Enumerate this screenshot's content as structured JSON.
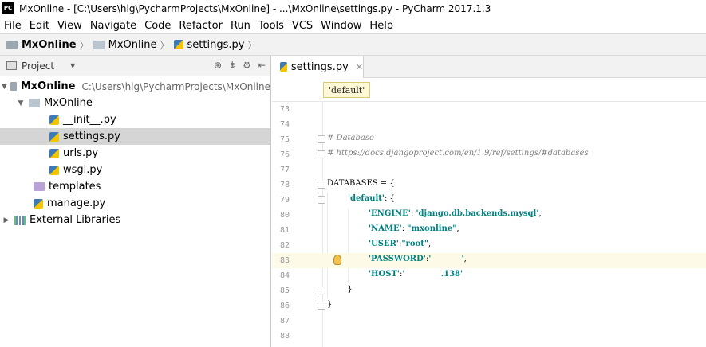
{
  "window": {
    "app_icon_text": "PC",
    "title": "MxOnline - [C:\\Users\\hlg\\PycharmProjects\\MxOnline] - ...\\MxOnline\\settings.py - PyCharm 2017.1.3"
  },
  "menu": [
    "File",
    "Edit",
    "View",
    "Navigate",
    "Code",
    "Refactor",
    "Run",
    "Tools",
    "VCS",
    "Window",
    "Help"
  ],
  "navbar": {
    "crumbs": [
      "MxOnline",
      "MxOnline",
      "settings.py"
    ]
  },
  "project_panel": {
    "label": "Project",
    "tree": [
      {
        "name": "MxOnline",
        "path": "C:\\Users\\hlg\\PycharmProjects\\MxOnline"
      },
      {
        "name": "MxOnline"
      },
      {
        "name": "__init__.py"
      },
      {
        "name": "settings.py"
      },
      {
        "name": "urls.py"
      },
      {
        "name": "wsgi.py"
      },
      {
        "name": "templates"
      },
      {
        "name": "manage.py"
      },
      {
        "name": "External Libraries"
      }
    ]
  },
  "editor": {
    "tab_label": "settings.py",
    "breadcrumb_tag": "'default'",
    "lines": [
      {
        "num": "73"
      },
      {
        "num": "74"
      },
      {
        "num": "75",
        "comment": "# Database"
      },
      {
        "num": "76",
        "comment": "# https://docs.djangoproject.com/en/1.9/ref/settings/#databases"
      },
      {
        "num": "77"
      },
      {
        "num": "78",
        "plain": "DATABASES = {"
      },
      {
        "num": "79",
        "key": "'default'",
        "rest": ": {"
      },
      {
        "num": "80",
        "key": "'ENGINE'",
        "sep": ": ",
        "val": "'django.db.backends.mysql'",
        "tail": ","
      },
      {
        "num": "81",
        "key": "'NAME'",
        "sep": ": ",
        "val": "\"mxonline\"",
        "tail": ","
      },
      {
        "num": "82",
        "key": "'USER'",
        "sep": ":",
        "val": "\"root\"",
        "tail": ","
      },
      {
        "num": "83",
        "key": "'PASSWORD'",
        "sep": ":",
        "val": "'           '",
        "tail": ","
      },
      {
        "num": "84",
        "key": "'HOST'",
        "sep": ":",
        "val": "'             .138'",
        "tail": ""
      },
      {
        "num": "85",
        "plain": "        }"
      },
      {
        "num": "86",
        "plain": "}"
      },
      {
        "num": "87"
      },
      {
        "num": "88"
      }
    ]
  }
}
